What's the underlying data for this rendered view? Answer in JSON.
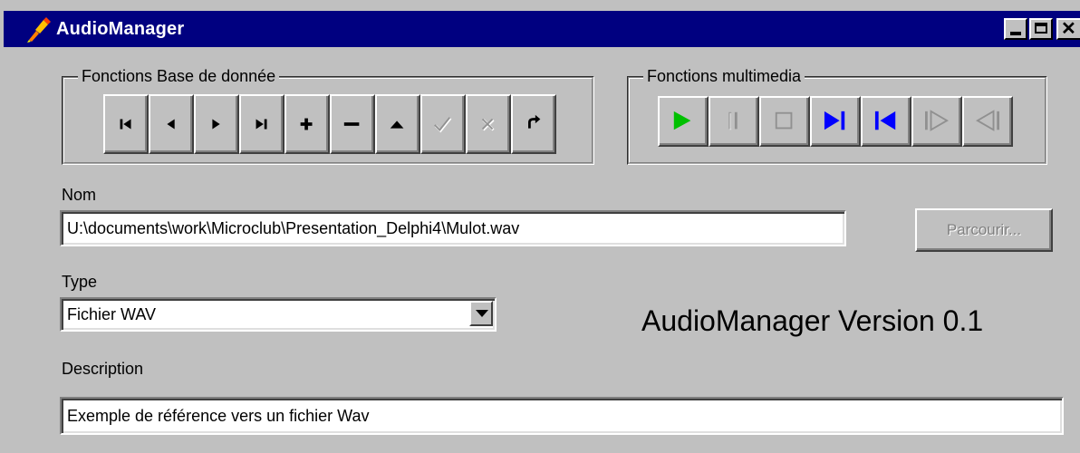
{
  "window": {
    "title": "AudioManager",
    "colors": {
      "titlebar": "#000080",
      "face": "#c0c0c0"
    }
  },
  "db_group": {
    "legend": "Fonctions Base de donnée",
    "buttons": [
      {
        "icon": "first-record-icon",
        "enabled": true
      },
      {
        "icon": "prior-record-icon",
        "enabled": true
      },
      {
        "icon": "next-record-icon",
        "enabled": true
      },
      {
        "icon": "last-record-icon",
        "enabled": true
      },
      {
        "icon": "insert-record-icon",
        "enabled": true
      },
      {
        "icon": "delete-record-icon",
        "enabled": true
      },
      {
        "icon": "edit-record-icon",
        "enabled": true
      },
      {
        "icon": "post-record-icon",
        "enabled": false
      },
      {
        "icon": "cancel-record-icon",
        "enabled": false
      },
      {
        "icon": "refresh-icon",
        "enabled": true
      }
    ]
  },
  "media_group": {
    "legend": "Fonctions multimedia",
    "buttons": [
      {
        "icon": "play-icon",
        "enabled": true,
        "color": "#00c000"
      },
      {
        "icon": "pause-icon",
        "enabled": false
      },
      {
        "icon": "stop-icon",
        "enabled": false
      },
      {
        "icon": "next-track-icon",
        "enabled": true,
        "color": "#0000ff"
      },
      {
        "icon": "previous-track-icon",
        "enabled": true,
        "color": "#0000ff"
      },
      {
        "icon": "step-forward-icon",
        "enabled": false
      },
      {
        "icon": "step-back-icon",
        "enabled": false
      }
    ]
  },
  "nom": {
    "label": "Nom",
    "value": "U:\\documents\\work\\Microclub\\Presentation_Delphi4\\Mulot.wav"
  },
  "browse": {
    "label": "Parcourir..."
  },
  "type": {
    "label": "Type",
    "selected": "Fichier WAV"
  },
  "version_text": "AudioManager Version 0.1",
  "description": {
    "label": "Description",
    "value": "Exemple de référence vers un fichier Wav"
  }
}
